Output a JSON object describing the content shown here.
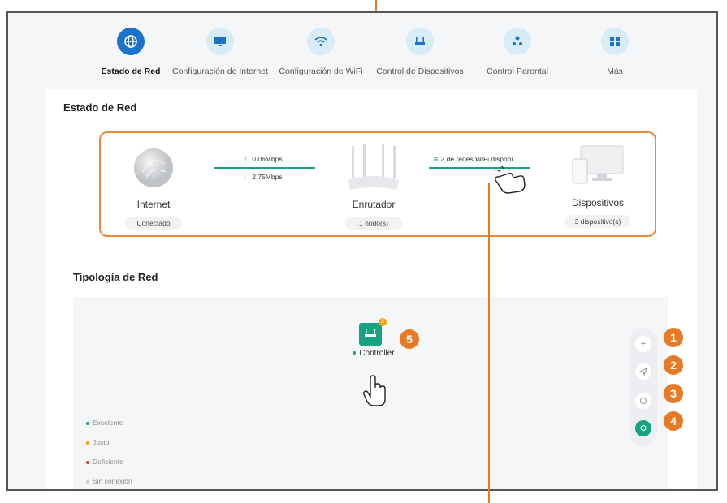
{
  "nav": {
    "items": [
      {
        "label": "Estado de Red",
        "icon": "globe-icon",
        "active": true
      },
      {
        "label": "Configuración de Internet",
        "icon": "monitor-icon",
        "active": false
      },
      {
        "label": "Configuración de WiFi",
        "icon": "wifi-icon",
        "active": false
      },
      {
        "label": "Control de Dispositivos",
        "icon": "router-icon",
        "active": false
      },
      {
        "label": "Control Parental",
        "icon": "parental-icon",
        "active": false
      },
      {
        "label": "Más",
        "icon": "grid-icon",
        "active": false
      }
    ]
  },
  "status": {
    "title": "Estado de Red",
    "internet": {
      "label": "Internet",
      "state": "Conectado"
    },
    "upload": "0.06Mbps",
    "download": "2.75Mbps",
    "router": {
      "label": "Enrutador",
      "nodes": "1 nodo(s)"
    },
    "wifi": "2 de redes WiFi disponi...",
    "devices": {
      "label": "Dispositivos",
      "count": "3 dispositivo(s)"
    }
  },
  "topology": {
    "title": "Tipología de Red",
    "controller": {
      "label": "Controller",
      "badge": "3"
    },
    "legend": [
      "Excelente",
      "Justo",
      "Deficiente",
      "Sin conexión"
    ],
    "legend_colors": [
      "#16a383",
      "#f2a20c",
      "#e53935",
      "#cccccc"
    ],
    "tools": [
      "add-icon",
      "send-icon",
      "refresh-icon",
      "optimize-icon"
    ]
  },
  "callouts": [
    "1",
    "2",
    "3",
    "4",
    "5"
  ],
  "colors": {
    "accent": "#1a73c9",
    "callout": "#e97a25",
    "link": "#16a383"
  }
}
